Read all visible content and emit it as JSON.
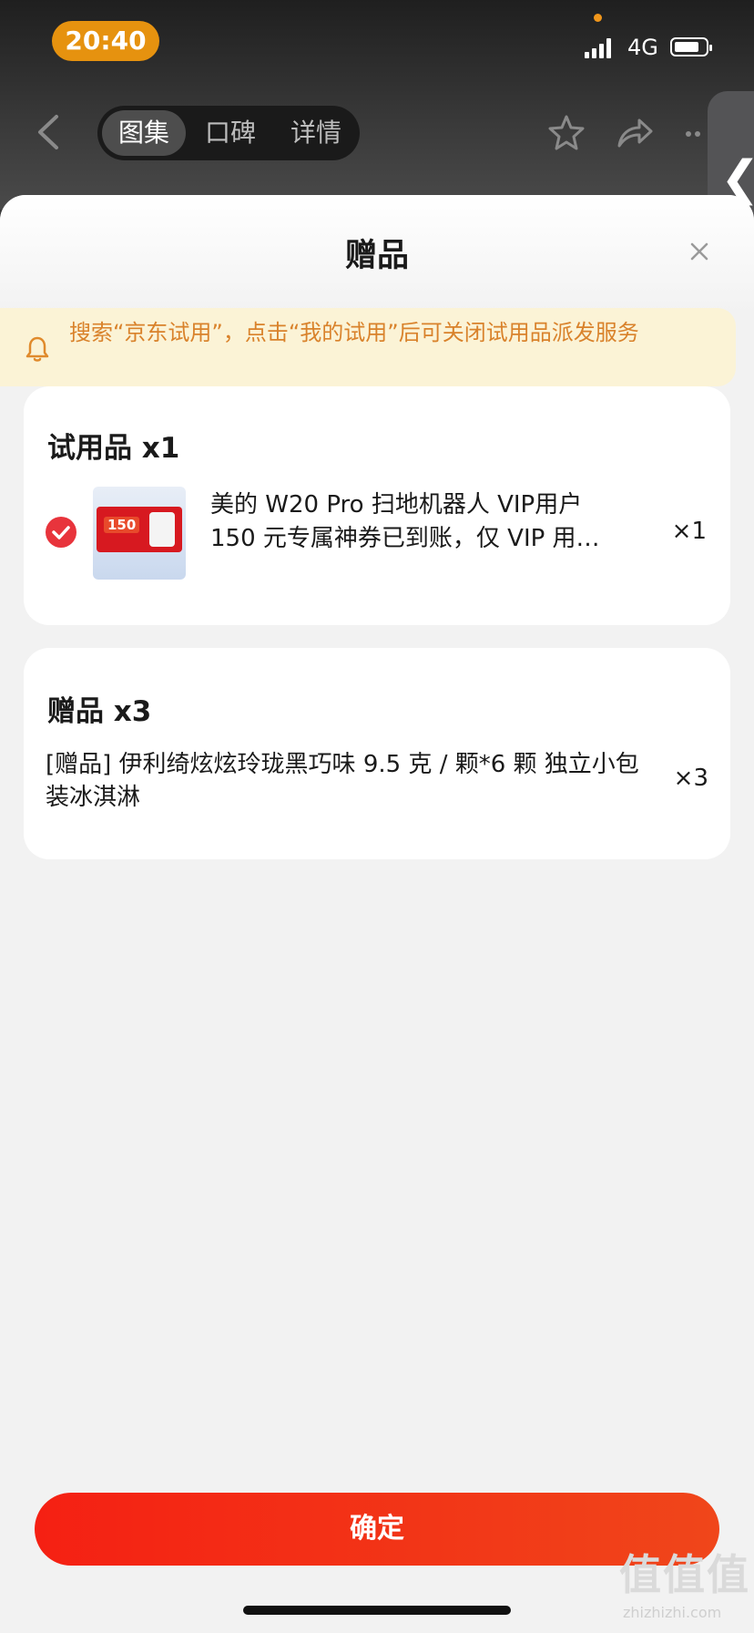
{
  "status_bar": {
    "time": "20:40",
    "network": "4G"
  },
  "nav": {
    "tabs": [
      {
        "label": "图集",
        "active": true
      },
      {
        "label": "口碑",
        "active": false
      },
      {
        "label": "详情",
        "active": false
      }
    ]
  },
  "sheet": {
    "title": "赠品",
    "notice": "搜索“京东试用”，点击“我的试用”后可关闭试用品派发服务",
    "trial_section": {
      "title": "试用品 x1",
      "item": {
        "name_line1": "美的 W20 Pro 扫地机器人 VIP用户",
        "name_line2": "150 元专属神券已到账，仅 VIP 用…",
        "quantity": "×1",
        "thumb_label": "150",
        "checked": true
      }
    },
    "gift_section": {
      "title": "赠品 x3",
      "item": {
        "name": "[赠品] 伊利绮炫炫玲珑黑巧味 9.5 克 / 颗*6 颗  独立小包装冰淇淋",
        "quantity": "×3"
      }
    },
    "confirm_label": "确定"
  },
  "watermark": {
    "logo": "值值值",
    "url": "zhizhizhi.com"
  },
  "colors": {
    "accent_orange": "#e6920f",
    "notice_text": "#d9822b",
    "notice_bg": "#fbf3d6",
    "button_red": "#f52013",
    "check_red": "#e8343c"
  }
}
